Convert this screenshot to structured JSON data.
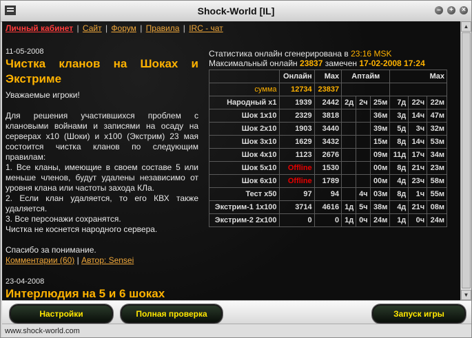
{
  "window": {
    "title": "Shock-World [IL]"
  },
  "nav": {
    "items": [
      "Личный кабинет",
      "Сайт",
      "Форум",
      "Правила",
      "IRC - чат"
    ],
    "separator": "|"
  },
  "news": [
    {
      "date": "11-05-2008",
      "title_line1": "Чистка кланов на Шоках и",
      "title_line2": "Экстриме",
      "greeting": "Уважаемые игроки!",
      "body": [
        "Для решения участившихся проблем с клановыми войнами и записями на осаду на серверах x10 (Шоки) и x100 (Экстрим) 23 мая состоится чистка кланов по следующим правилам:",
        "1. Все кланы, имеющие в своем составе 5 или меньше членов, будут удалены независимо от уровня клана или частоты захода КЛа.",
        "2. Если клан удаляется, то его КВХ также удаляется.",
        "3. Все персонажи сохранятся.",
        "Чистка не коснется народного сервера."
      ],
      "thanks": "Спасибо за понимание.",
      "comments": "Комментарии (60)",
      "link_sep": "|",
      "author": "Автор: Sensei"
    },
    {
      "date": "23-04-2008",
      "title_line1": "Интерлюдия на 5 и 6 шоках"
    }
  ],
  "stats": {
    "line1_prefix": "Статистика онлайн сгенерирована в",
    "line1_time": "23:16 MSK",
    "line2_prefix": "Максимальный онлайн",
    "line2_max": "23837",
    "line2_mid": "замечен",
    "line2_date": "17-02-2008 17:24",
    "headers": {
      "online": "Онлайн",
      "max": "Max",
      "uptime": "Аптайм",
      "maxup": "Max"
    },
    "sum": {
      "label": "сумма",
      "online": "12734",
      "max": "23837"
    },
    "rows": [
      {
        "name": "Народный x1",
        "online": "1939",
        "max": "2442",
        "ud": "2д",
        "uh": "2ч",
        "um": "25м",
        "md": "7д",
        "mh": "22ч",
        "mm": "22м"
      },
      {
        "name": "Шок 1x10",
        "online": "2329",
        "max": "3818",
        "ud": "",
        "uh": "",
        "um": "36м",
        "md": "3д",
        "mh": "14ч",
        "mm": "47м"
      },
      {
        "name": "Шок 2x10",
        "online": "1903",
        "max": "3440",
        "ud": "",
        "uh": "",
        "um": "39м",
        "md": "5д",
        "mh": "3ч",
        "mm": "32м"
      },
      {
        "name": "Шок 3x10",
        "online": "1629",
        "max": "3432",
        "ud": "",
        "uh": "",
        "um": "15м",
        "md": "8д",
        "mh": "14ч",
        "mm": "53м"
      },
      {
        "name": "Шок 4x10",
        "online": "1123",
        "max": "2676",
        "ud": "",
        "uh": "",
        "um": "09м",
        "md": "11д",
        "mh": "17ч",
        "mm": "34м"
      },
      {
        "name": "Шок 5x10",
        "online": "Offline",
        "max": "1530",
        "ud": "",
        "uh": "",
        "um": "00м",
        "md": "8д",
        "mh": "21ч",
        "mm": "23м"
      },
      {
        "name": "Шок 6x10",
        "online": "Offline",
        "max": "1789",
        "ud": "",
        "uh": "",
        "um": "00м",
        "md": "4д",
        "mh": "23ч",
        "mm": "58м"
      },
      {
        "name": "Тест x50",
        "online": "97",
        "max": "94",
        "ud": "",
        "uh": "4ч",
        "um": "03м",
        "md": "8д",
        "mh": "1ч",
        "mm": "55м"
      },
      {
        "name": "Экстрим-1 1x100",
        "online": "3714",
        "max": "4616",
        "ud": "1д",
        "uh": "5ч",
        "um": "38м",
        "md": "4д",
        "mh": "21ч",
        "mm": "08м"
      },
      {
        "name": "Экстрим-2 2x100",
        "online": "0",
        "max": "0",
        "ud": "1д",
        "uh": "0ч",
        "um": "24м",
        "md": "1д",
        "mh": "0ч",
        "mm": "24м"
      }
    ]
  },
  "buttons": {
    "settings": "Настройки",
    "check": "Полная проверка",
    "launch": "Запуск игры"
  },
  "status": {
    "url": "www.shock-world.com"
  }
}
